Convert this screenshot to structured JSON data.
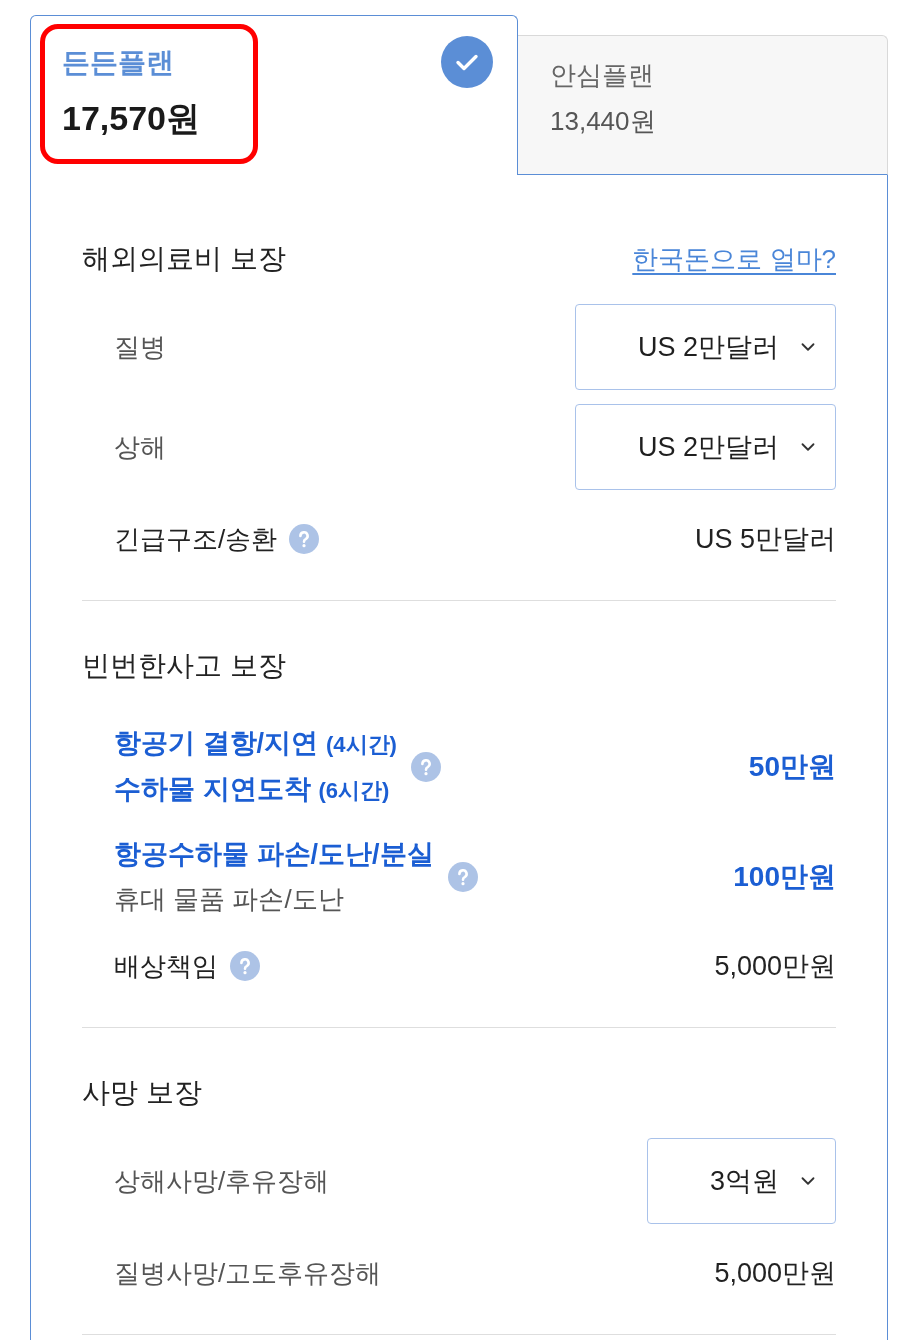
{
  "plans": [
    {
      "name": "든든플랜",
      "price": "17,570원",
      "selected": true,
      "highlighted": true
    },
    {
      "name": "안심플랜",
      "price": "13,440원",
      "selected": false,
      "highlighted": false
    }
  ],
  "sections": [
    {
      "title": "해외의료비 보장",
      "link": "한국돈으로 얼마?",
      "rows": [
        {
          "kind": "select",
          "label": "질병",
          "help": false,
          "value": "US 2만달러"
        },
        {
          "kind": "select",
          "label": "상해",
          "help": false,
          "value": "US 2만달러"
        },
        {
          "kind": "text",
          "label": "긴급구조/송환",
          "help": true,
          "value": "US 5만달러"
        }
      ]
    },
    {
      "title": "빈번한사고 보장",
      "rows": [
        {
          "kind": "featured",
          "lines": [
            {
              "text": "항공기 결항/지연",
              "note": "(4시간)",
              "emphasis": true
            },
            {
              "text": "수하물 지연도착",
              "note": "(6시간)",
              "emphasis": true
            }
          ],
          "help": true,
          "value": "50만원"
        },
        {
          "kind": "featured",
          "lines": [
            {
              "text": "항공수하물 파손/도난/분실",
              "emphasis": true
            },
            {
              "text": "휴대 물품 파손/도난",
              "emphasis": false
            }
          ],
          "help": true,
          "value": "100만원"
        },
        {
          "kind": "text",
          "label": "배상책임",
          "help": true,
          "value": "5,000만원"
        }
      ]
    },
    {
      "title": "사망 보장",
      "rows": [
        {
          "kind": "select",
          "label": "상해사망/후유장해",
          "help": false,
          "value": "3억원"
        },
        {
          "kind": "text",
          "label": "질병사망/고도후유장해",
          "help": false,
          "value": "5,000만원"
        }
      ]
    }
  ]
}
